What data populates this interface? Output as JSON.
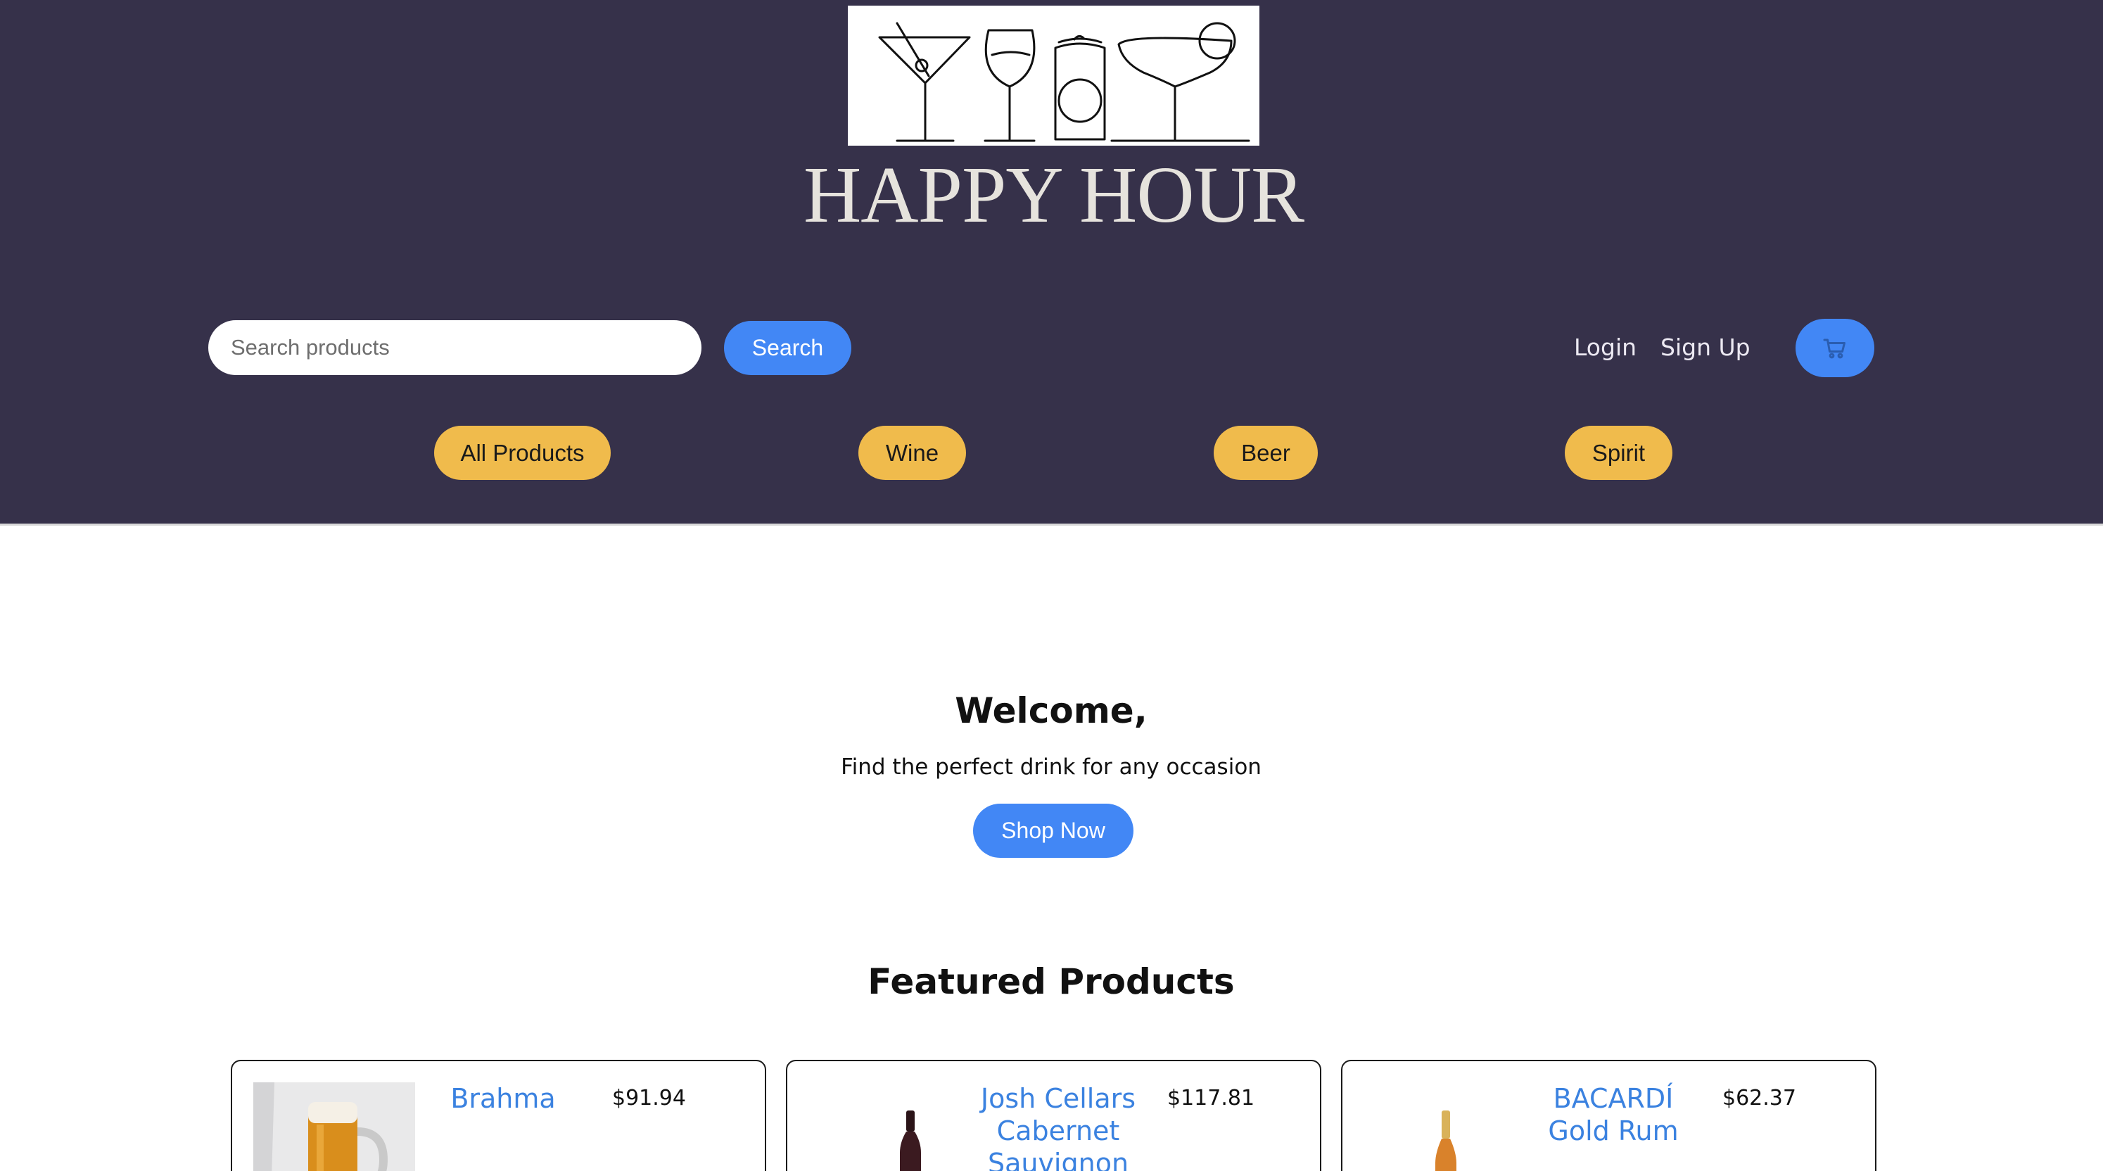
{
  "header": {
    "brand": "HAPPY HOUR",
    "logo_icon": "cocktail-glasses-logo",
    "search": {
      "placeholder": "Search products",
      "value": "",
      "button_label": "Search"
    },
    "auth": {
      "login_label": "Login",
      "signup_label": "Sign Up"
    },
    "cart_icon": "cart-icon",
    "categories": [
      {
        "label": "All Products"
      },
      {
        "label": "Wine"
      },
      {
        "label": "Beer"
      },
      {
        "label": "Spirit"
      }
    ]
  },
  "hero": {
    "title": "Welcome,",
    "subtitle": "Find the perfect drink for any occasion",
    "cta_label": "Shop Now"
  },
  "featured": {
    "title": "Featured Products",
    "products": [
      {
        "name": "Brahma",
        "price": "$91.94",
        "image_icon": "beer-mug-image"
      },
      {
        "name": "Josh Cellars Cabernet Sauvignon",
        "price": "$117.81",
        "image_icon": "wine-bottle-image"
      },
      {
        "name": "BACARDÍ Gold Rum",
        "price": "$62.37",
        "image_icon": "rum-bottle-image"
      }
    ]
  },
  "colors": {
    "header_bg": "#36314a",
    "primary_button": "#4287f5",
    "category_button": "#f0bb4c",
    "product_link": "#3b82e0"
  }
}
